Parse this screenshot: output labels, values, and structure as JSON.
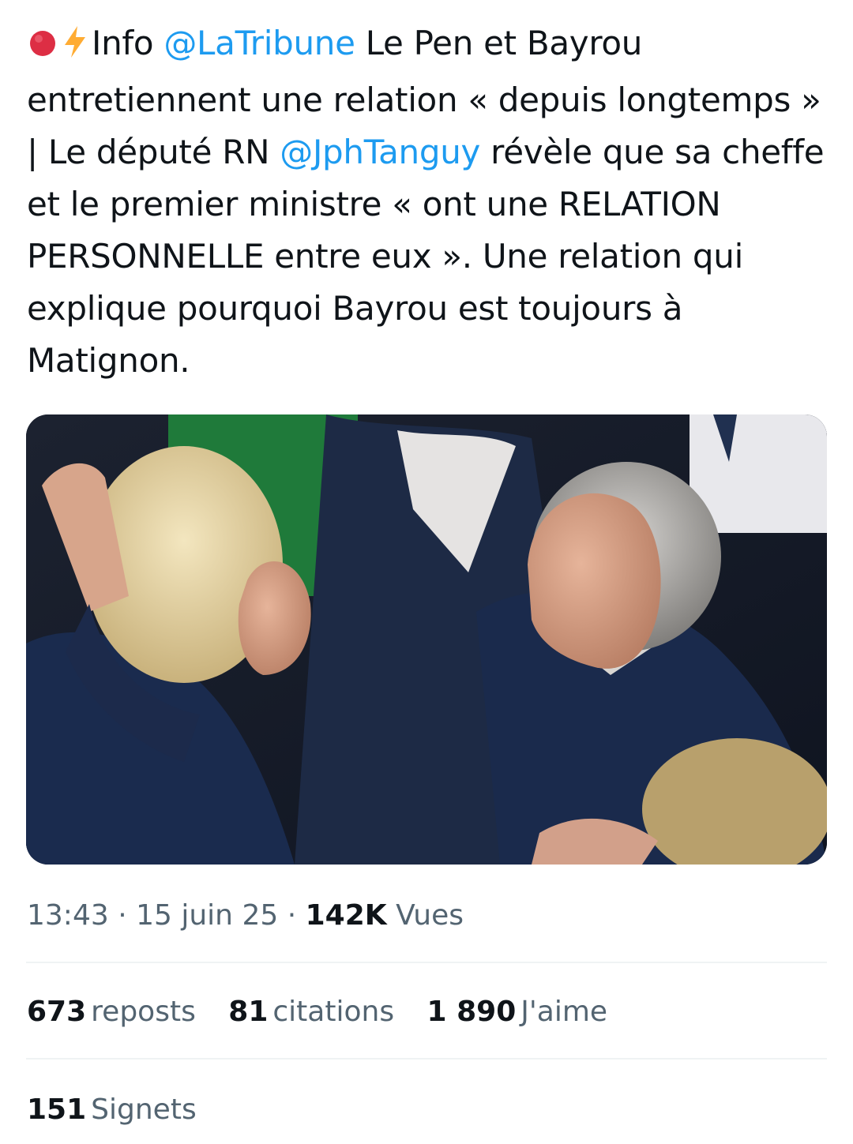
{
  "tweet": {
    "emoji_prefix": "🔴⚡",
    "text_segments": [
      {
        "type": "text",
        "value": "Info "
      },
      {
        "type": "mention",
        "value": "@LaTribune"
      },
      {
        "type": "text",
        "value": " Le Pen et Bayrou entretiennent une relation « depuis longtemps » | Le député RN "
      },
      {
        "type": "mention",
        "value": "@JphTanguy"
      },
      {
        "type": "text",
        "value": " révèle que sa cheffe et le premier ministre « ont une RELATION PERSONNELLE entre eux ». Une relation qui explique pourquoi Bayrou est toujours à Matignon."
      }
    ]
  },
  "meta": {
    "time": "13:43",
    "separator": "·",
    "date": "15 juin 25",
    "views_count": "142K",
    "views_label": "Vues"
  },
  "stats": {
    "reposts_count": "673",
    "reposts_label": "reposts",
    "quotes_count": "81",
    "quotes_label": "citations",
    "likes_count": "1 890",
    "likes_label": "J'aime",
    "bookmarks_count": "151",
    "bookmarks_label": "Signets"
  },
  "colors": {
    "mention": "#1d9bf0",
    "text_primary": "#0f1419",
    "text_secondary": "#536471",
    "divider": "#eff3f4"
  }
}
